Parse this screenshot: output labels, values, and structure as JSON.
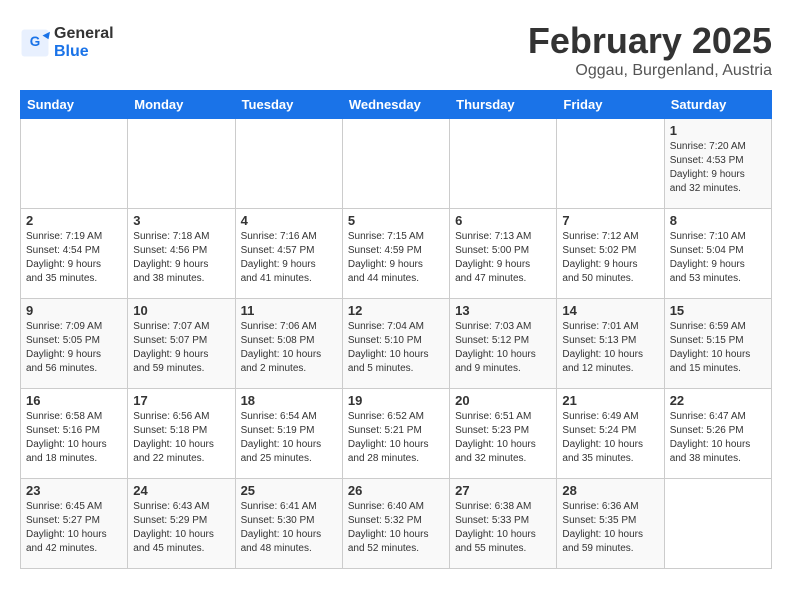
{
  "logo": {
    "general": "General",
    "blue": "Blue"
  },
  "title": "February 2025",
  "subtitle": "Oggau, Burgenland, Austria",
  "headers": [
    "Sunday",
    "Monday",
    "Tuesday",
    "Wednesday",
    "Thursday",
    "Friday",
    "Saturday"
  ],
  "weeks": [
    [
      {
        "day": "",
        "info": ""
      },
      {
        "day": "",
        "info": ""
      },
      {
        "day": "",
        "info": ""
      },
      {
        "day": "",
        "info": ""
      },
      {
        "day": "",
        "info": ""
      },
      {
        "day": "",
        "info": ""
      },
      {
        "day": "1",
        "info": "Sunrise: 7:20 AM\nSunset: 4:53 PM\nDaylight: 9 hours\nand 32 minutes."
      }
    ],
    [
      {
        "day": "2",
        "info": "Sunrise: 7:19 AM\nSunset: 4:54 PM\nDaylight: 9 hours\nand 35 minutes."
      },
      {
        "day": "3",
        "info": "Sunrise: 7:18 AM\nSunset: 4:56 PM\nDaylight: 9 hours\nand 38 minutes."
      },
      {
        "day": "4",
        "info": "Sunrise: 7:16 AM\nSunset: 4:57 PM\nDaylight: 9 hours\nand 41 minutes."
      },
      {
        "day": "5",
        "info": "Sunrise: 7:15 AM\nSunset: 4:59 PM\nDaylight: 9 hours\nand 44 minutes."
      },
      {
        "day": "6",
        "info": "Sunrise: 7:13 AM\nSunset: 5:00 PM\nDaylight: 9 hours\nand 47 minutes."
      },
      {
        "day": "7",
        "info": "Sunrise: 7:12 AM\nSunset: 5:02 PM\nDaylight: 9 hours\nand 50 minutes."
      },
      {
        "day": "8",
        "info": "Sunrise: 7:10 AM\nSunset: 5:04 PM\nDaylight: 9 hours\nand 53 minutes."
      }
    ],
    [
      {
        "day": "9",
        "info": "Sunrise: 7:09 AM\nSunset: 5:05 PM\nDaylight: 9 hours\nand 56 minutes."
      },
      {
        "day": "10",
        "info": "Sunrise: 7:07 AM\nSunset: 5:07 PM\nDaylight: 9 hours\nand 59 minutes."
      },
      {
        "day": "11",
        "info": "Sunrise: 7:06 AM\nSunset: 5:08 PM\nDaylight: 10 hours\nand 2 minutes."
      },
      {
        "day": "12",
        "info": "Sunrise: 7:04 AM\nSunset: 5:10 PM\nDaylight: 10 hours\nand 5 minutes."
      },
      {
        "day": "13",
        "info": "Sunrise: 7:03 AM\nSunset: 5:12 PM\nDaylight: 10 hours\nand 9 minutes."
      },
      {
        "day": "14",
        "info": "Sunrise: 7:01 AM\nSunset: 5:13 PM\nDaylight: 10 hours\nand 12 minutes."
      },
      {
        "day": "15",
        "info": "Sunrise: 6:59 AM\nSunset: 5:15 PM\nDaylight: 10 hours\nand 15 minutes."
      }
    ],
    [
      {
        "day": "16",
        "info": "Sunrise: 6:58 AM\nSunset: 5:16 PM\nDaylight: 10 hours\nand 18 minutes."
      },
      {
        "day": "17",
        "info": "Sunrise: 6:56 AM\nSunset: 5:18 PM\nDaylight: 10 hours\nand 22 minutes."
      },
      {
        "day": "18",
        "info": "Sunrise: 6:54 AM\nSunset: 5:19 PM\nDaylight: 10 hours\nand 25 minutes."
      },
      {
        "day": "19",
        "info": "Sunrise: 6:52 AM\nSunset: 5:21 PM\nDaylight: 10 hours\nand 28 minutes."
      },
      {
        "day": "20",
        "info": "Sunrise: 6:51 AM\nSunset: 5:23 PM\nDaylight: 10 hours\nand 32 minutes."
      },
      {
        "day": "21",
        "info": "Sunrise: 6:49 AM\nSunset: 5:24 PM\nDaylight: 10 hours\nand 35 minutes."
      },
      {
        "day": "22",
        "info": "Sunrise: 6:47 AM\nSunset: 5:26 PM\nDaylight: 10 hours\nand 38 minutes."
      }
    ],
    [
      {
        "day": "23",
        "info": "Sunrise: 6:45 AM\nSunset: 5:27 PM\nDaylight: 10 hours\nand 42 minutes."
      },
      {
        "day": "24",
        "info": "Sunrise: 6:43 AM\nSunset: 5:29 PM\nDaylight: 10 hours\nand 45 minutes."
      },
      {
        "day": "25",
        "info": "Sunrise: 6:41 AM\nSunset: 5:30 PM\nDaylight: 10 hours\nand 48 minutes."
      },
      {
        "day": "26",
        "info": "Sunrise: 6:40 AM\nSunset: 5:32 PM\nDaylight: 10 hours\nand 52 minutes."
      },
      {
        "day": "27",
        "info": "Sunrise: 6:38 AM\nSunset: 5:33 PM\nDaylight: 10 hours\nand 55 minutes."
      },
      {
        "day": "28",
        "info": "Sunrise: 6:36 AM\nSunset: 5:35 PM\nDaylight: 10 hours\nand 59 minutes."
      },
      {
        "day": "",
        "info": ""
      }
    ]
  ]
}
